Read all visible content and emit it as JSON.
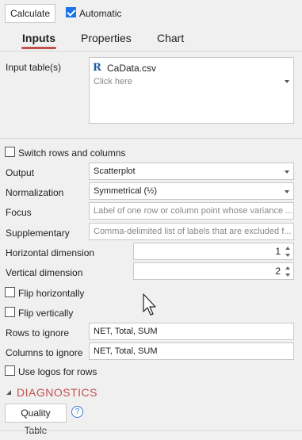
{
  "toolbar": {
    "calculate_label": "Calculate",
    "automatic_label": "Automatic",
    "automatic_checked": true
  },
  "tabs": [
    {
      "label": "Inputs",
      "active": true
    },
    {
      "label": "Properties"
    },
    {
      "label": "Chart"
    }
  ],
  "input_table": {
    "label": "Input table(s)",
    "file_icon": "R",
    "file_name": "CaData.csv",
    "add_placeholder": "Click here"
  },
  "switch_rows": {
    "label": "Switch rows and columns",
    "checked": false
  },
  "output": {
    "label": "Output",
    "value": "Scatterplot"
  },
  "normalization": {
    "label": "Normalization",
    "value": "Symmetrical (½)"
  },
  "focus": {
    "label": "Focus",
    "placeholder": "Label of one row or column point whose variance ..."
  },
  "supplementary": {
    "label": "Supplementary",
    "placeholder": "Comma-delimited list of labels that are excluded f..."
  },
  "horizontal_dimension": {
    "label": "Horizontal dimension",
    "value": "1"
  },
  "vertical_dimension": {
    "label": "Vertical dimension",
    "value": "2"
  },
  "flip_h": {
    "label": "Flip horizontally",
    "checked": false
  },
  "flip_v": {
    "label": "Flip vertically",
    "checked": false
  },
  "rows_to_ignore": {
    "label": "Rows to ignore",
    "value": "NET, Total, SUM"
  },
  "columns_to_ignore": {
    "label": "Columns to ignore",
    "value": "NET, Total, SUM"
  },
  "use_logos": {
    "label": "Use logos for rows",
    "checked": false
  },
  "diagnostics": {
    "header": "DIAGNOSTICS",
    "quality_table_label": "Quality Table",
    "help_glyph": "?"
  }
}
